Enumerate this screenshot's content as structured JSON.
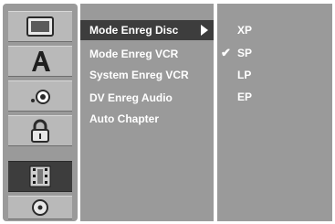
{
  "menu": {
    "items": [
      {
        "label": "Mode Enreg Disc"
      },
      {
        "label": "Mode Enreg VCR"
      },
      {
        "label": "System Enreg VCR"
      },
      {
        "label": "DV Enreg Audio"
      },
      {
        "label": "Auto Chapter"
      }
    ],
    "selected_index": 0
  },
  "options": {
    "items": [
      {
        "label": "XP",
        "checked": false
      },
      {
        "label": "SP",
        "checked": true
      },
      {
        "label": "LP",
        "checked": false
      },
      {
        "label": "EP",
        "checked": false
      }
    ],
    "check_glyph": "✔"
  },
  "sidebar": {
    "icons": [
      "tv-screen-icon",
      "language-letter-icon",
      "audio-speaker-icon",
      "lock-icon",
      "film-record-icon",
      "disc-icon"
    ],
    "active_index": 4
  },
  "colors": {
    "panel": "#9a9a9a",
    "selected": "#3d3d3d",
    "text": "#ffffff"
  }
}
